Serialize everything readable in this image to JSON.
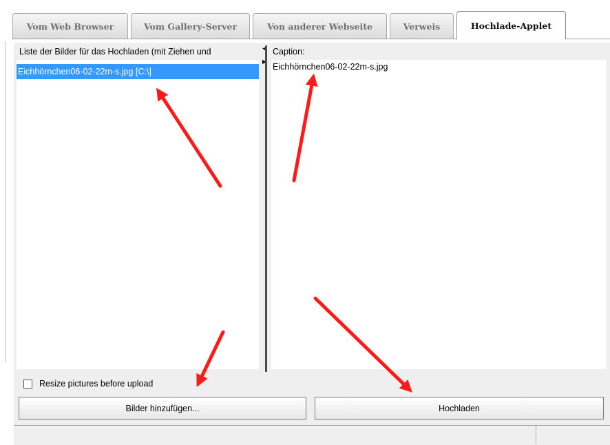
{
  "tabs": [
    {
      "label": "Vom Web Browser",
      "active": false
    },
    {
      "label": "Vom Gallery-Server",
      "active": false
    },
    {
      "label": "Von anderer Webseite",
      "active": false
    },
    {
      "label": "Verweis",
      "active": false
    },
    {
      "label": "Hochlade-Applet",
      "active": true
    }
  ],
  "file_list": {
    "header": "Liste der Bilder für das Hochladen (mit Ziehen und",
    "items": [
      "Eichhörnchen06-02-22m-s.jpg [C:\\]"
    ]
  },
  "caption": {
    "label": "Caption:",
    "value": "Eichhörnchen06-02-22m-s.jpg"
  },
  "resize": {
    "label": "Resize pictures before upload",
    "checked": false
  },
  "buttons": {
    "add": "Bilder hinzufügen...",
    "upload": "Hochladen"
  },
  "status": {
    "text": ""
  },
  "colors": {
    "selection": "#3399ff",
    "annotation_arrow": "#ff1a1a",
    "panel": "#efefef"
  }
}
